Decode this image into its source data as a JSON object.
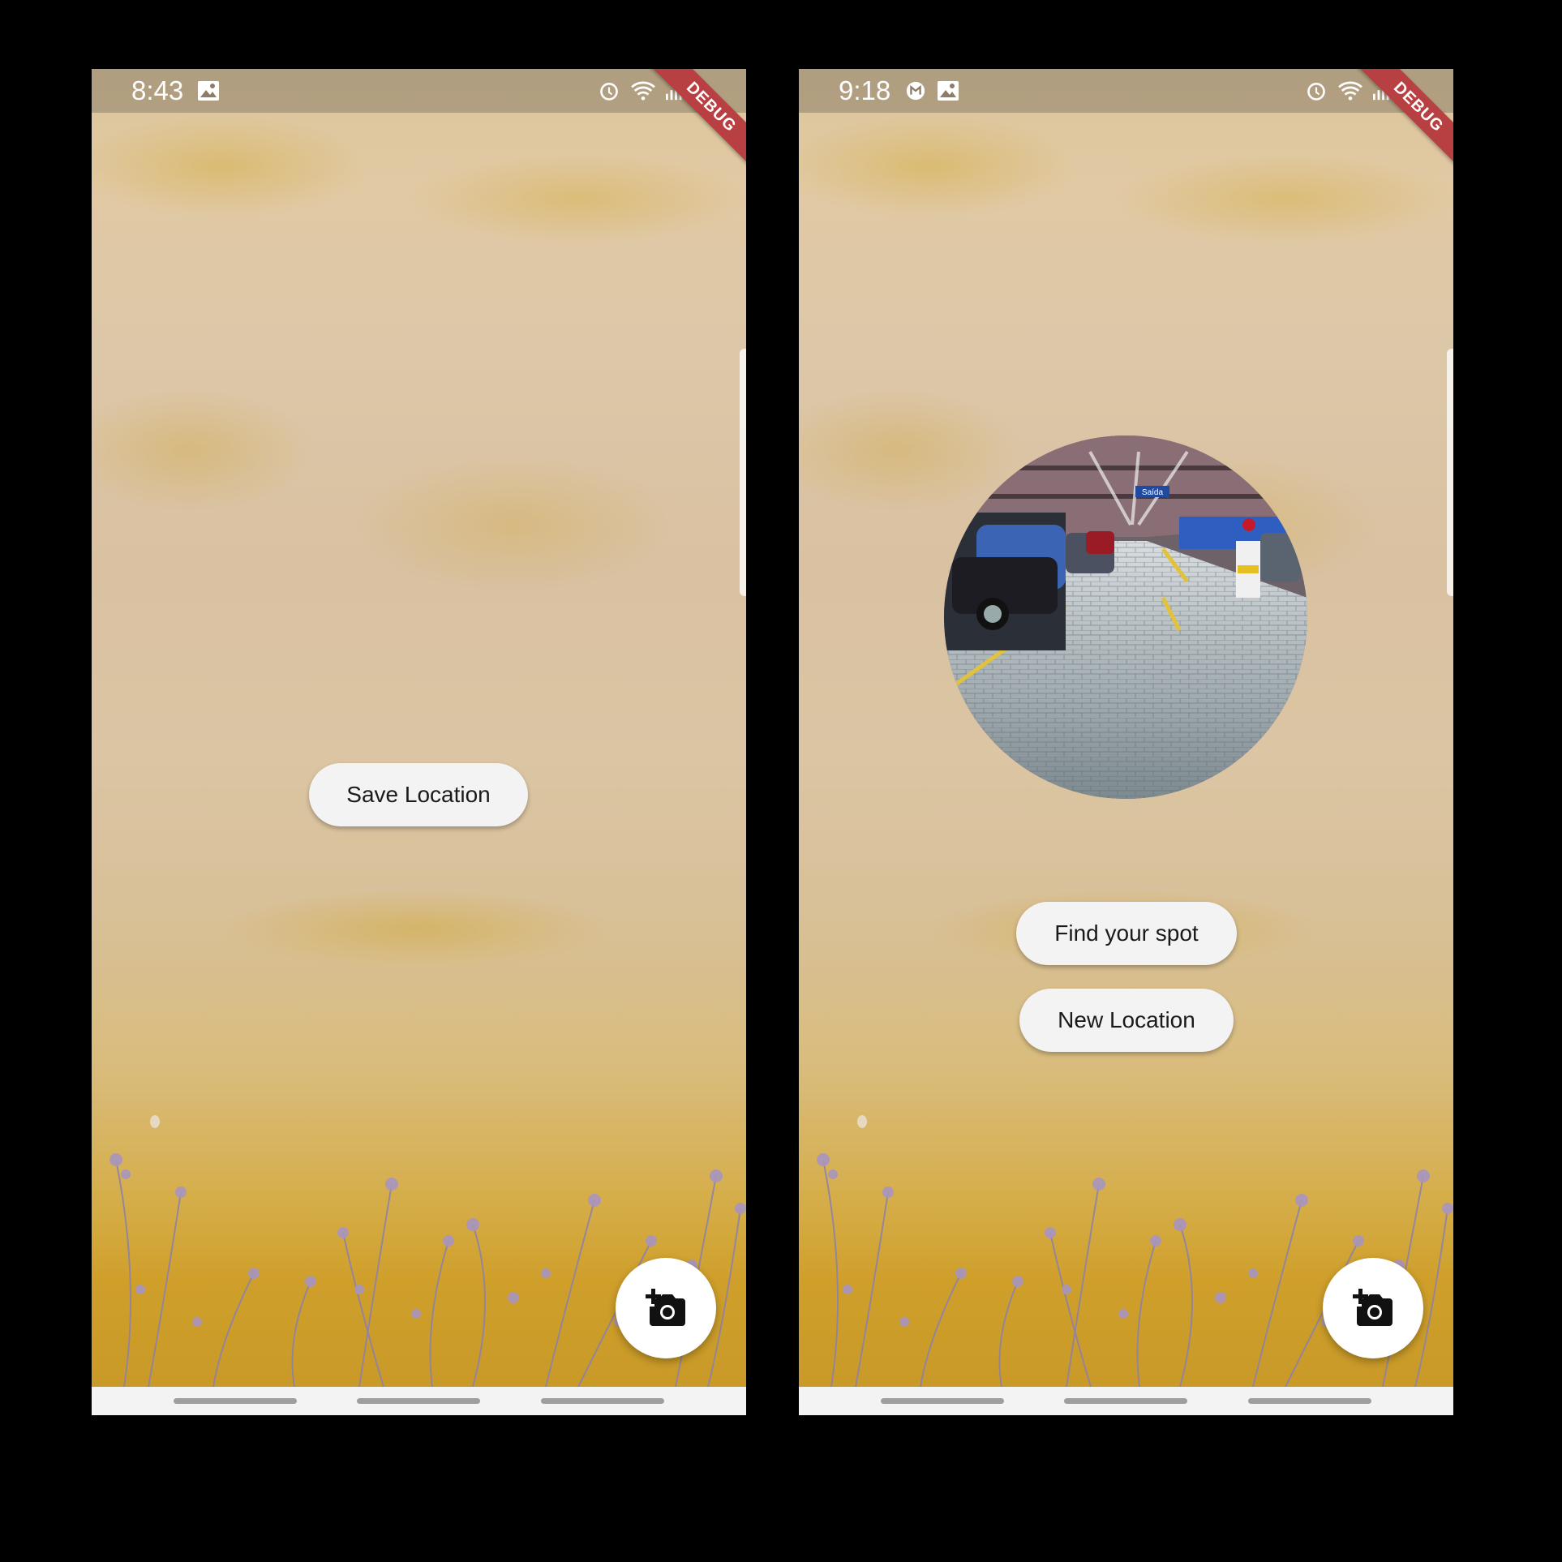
{
  "screens": [
    {
      "status": {
        "time": "8:43"
      },
      "debug_banner": "DEBUG",
      "buttons": {
        "save_location": "Save Location"
      },
      "fab_icon": "add-a-photo-icon"
    },
    {
      "status": {
        "time": "9:18"
      },
      "debug_banner": "DEBUG",
      "photo": {
        "sign_text": "Saída"
      },
      "buttons": {
        "find_spot": "Find your spot",
        "new_location": "New Location"
      },
      "fab_icon": "add-a-photo-icon"
    }
  ],
  "colors": {
    "wall_light": "#dcc7a8",
    "wall_yellow": "#cf9f2a",
    "debug_red": "#b84042",
    "button_bg": "#f3f3f3"
  }
}
